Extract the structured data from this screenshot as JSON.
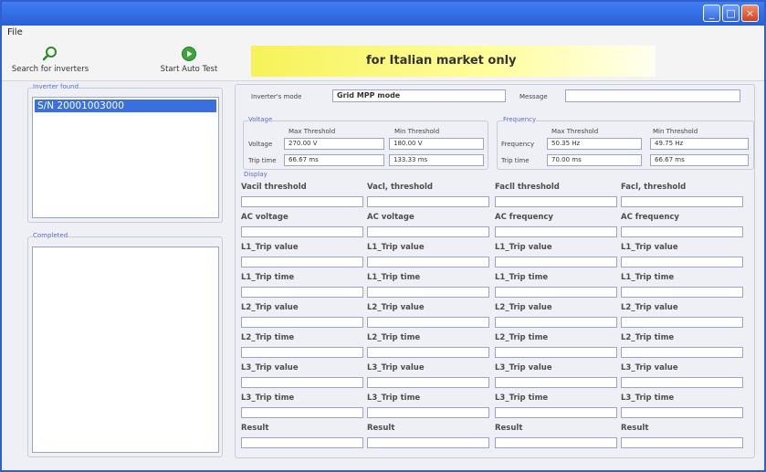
{
  "window": {
    "controls": [
      "_",
      "□",
      "×"
    ]
  },
  "menu": {
    "file": "File"
  },
  "toolbar": {
    "search_label": "Search for inverters",
    "auto_test_label": "Start Auto Test",
    "banner_text": "for Italian market only"
  },
  "inverter_found": {
    "label": "Inverter found",
    "items": [
      "S/N 20001003000"
    ]
  },
  "completed": {
    "label": "Completed"
  },
  "status": {
    "mode_label": "Inverter's mode",
    "mode_value": "Grid MPP mode",
    "message_label": "Message",
    "message_value": ""
  },
  "voltage": {
    "group_label": "Voltage",
    "col_max": "Max Threshold",
    "col_min": "Min Threshold",
    "row1_label": "Voltage",
    "row1_max": "270.00 V",
    "row1_min": "180.00 V",
    "row2_label": "Trip time",
    "row2_max": "66.67 ms",
    "row2_min": "133.33 ms"
  },
  "frequency": {
    "group_label": "Frequency",
    "col_max": "Max Threshold",
    "col_min": "Min Threshold",
    "row1_label": "Frequency",
    "row1_max": "50.35 Hz",
    "row1_min": "49.75 Hz",
    "row2_label": "Trip time",
    "row2_max": "70.00 ms",
    "row2_min": "66.67 ms"
  },
  "display": {
    "group_label": "Display",
    "rows": [
      [
        "Vacil threshold",
        "Vacl, threshold",
        "Facll threshold",
        "Facl, threshold"
      ],
      [
        "AC voltage",
        "AC voltage",
        "AC frequency",
        "AC frequency"
      ],
      [
        "L1_Trip value",
        "L1_Trip value",
        "L1_Trip value",
        "L1_Trip value"
      ],
      [
        "L1_Trip time",
        "L1_Trip time",
        "L1_Trip time",
        "L1_Trip time"
      ],
      [
        "L2_Trip value",
        "L2_Trip value",
        "L2_Trip value",
        "L2_Trip value"
      ],
      [
        "L2_Trip time",
        "L2_Trip time",
        "L2_Trip time",
        "L2_Trip time"
      ],
      [
        "L3_Trip value",
        "L3_Trip value",
        "L3_Trip value",
        "L3_Trip value"
      ],
      [
        "L3_Trip time",
        "L3_Trip time",
        "L3_Trip time",
        "L3_Trip time"
      ],
      [
        "Result",
        "Result",
        "Result",
        "Result"
      ]
    ]
  },
  "colors": {
    "title_bar": "#2a5fd6",
    "selection": "#3a6fde",
    "banner": "#f6f25a",
    "group_label": "#5a6ad0"
  }
}
